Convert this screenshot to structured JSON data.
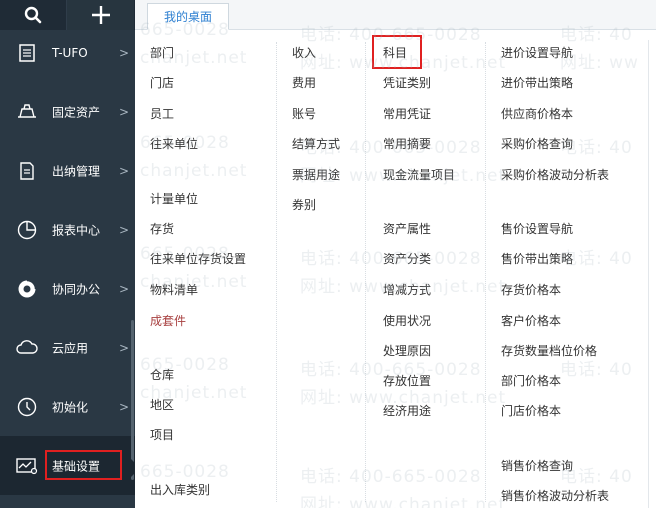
{
  "tabs": [
    {
      "label": "我的桌面"
    }
  ],
  "sidebar": {
    "items": [
      {
        "label": "T-UFO",
        "icon": "tufo-icon"
      },
      {
        "label": "固定资产",
        "icon": "fixed-assets-icon"
      },
      {
        "label": "出纳管理",
        "icon": "cashier-icon"
      },
      {
        "label": "报表中心",
        "icon": "pie-chart-icon"
      },
      {
        "label": "协同办公",
        "icon": "collaboration-icon"
      },
      {
        "label": "云应用",
        "icon": "cloud-icon"
      },
      {
        "label": "初始化",
        "icon": "clock-icon"
      },
      {
        "label": "基础设置",
        "icon": "basic-settings-icon"
      }
    ],
    "arrow": ">"
  },
  "menu": {
    "col1": [
      "部门",
      "门店",
      "员工",
      "往来单位",
      "计量单位",
      "存货",
      "往来单位存货设置",
      "物料清单",
      "成套件",
      "仓库",
      "地区",
      "项目",
      "出入库类别"
    ],
    "col2": [
      "收入",
      "费用",
      "账号",
      "结算方式",
      "票据用途",
      "券别"
    ],
    "col3": [
      "科目",
      "凭证类别",
      "常用凭证",
      "常用摘要",
      "现金流量项目",
      "资产属性",
      "资产分类",
      "增减方式",
      "使用状况",
      "处理原因",
      "存放位置",
      "经济用途"
    ],
    "col4": [
      "进价设置导航",
      "进价带出策略",
      "供应商价格本",
      "采购价格查询",
      "采购价格波动分析表",
      "售价设置导航",
      "售价带出策略",
      "存货价格本",
      "客户价格本",
      "存货数量档位价格",
      "部门价格本",
      "门店价格本",
      "销售价格查询",
      "销售价格波动分析表"
    ]
  },
  "watermark": {
    "phone": "电话: 400-665-0028",
    "site": "网址: www.chanjet.net",
    "phone_short": "665-0028",
    "site_short": "chanjet.net"
  }
}
